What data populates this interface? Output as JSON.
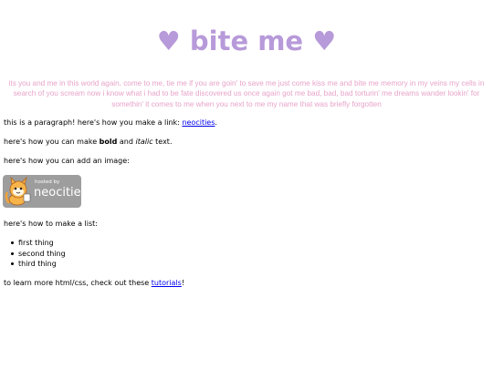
{
  "title": "♥ bite me ♥",
  "marquee": "its you and me in this world again, come to me, tie me if you are goin' to save me just come kiss me and bite me memory in my veins my cells in search of you scream now i know what i had to be fate discovered us once again got me bad, bad, bad torturin' me dreams wander lookin' for somethin' it comes to me when you next to me my name that was briefly forgotten",
  "colors": {
    "title": "#b79ad9",
    "marquee": "#e7a3c8",
    "link": "#0000ee",
    "badge_bg": "#9d9d9d"
  },
  "p1": {
    "before": "this is a paragraph! here's how you make a link: ",
    "link": "neocities",
    "after": "."
  },
  "p2": {
    "before": "here's how you can make ",
    "bold": "bold",
    "middle": " and ",
    "italic": "italic",
    "after": " text."
  },
  "p3": {
    "text": "here's how you can add an image:"
  },
  "badge": {
    "small": "hosted by",
    "big": "neocities",
    "icon": "neocities-cat-icon"
  },
  "p4": {
    "text": "here's how to make a list:"
  },
  "list": [
    "first thing",
    "second thing",
    "third thing"
  ],
  "p5": {
    "before": "to learn more html/css, check out these ",
    "link": "tutorials",
    "after": "!"
  }
}
